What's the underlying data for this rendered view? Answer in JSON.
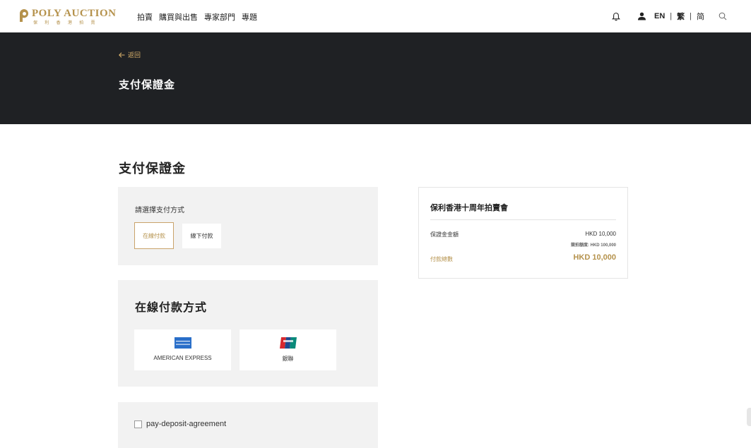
{
  "header": {
    "logo_text": "POLY AUCTION",
    "logo_sub": "保利香港拍賣",
    "nav": [
      "拍賣",
      "購買與出售",
      "專家部門",
      "專題"
    ],
    "icons": [
      "bell-icon",
      "user-icon",
      "search-icon"
    ],
    "lang_en": "EN",
    "lang_sep": "|",
    "lang_tc": "繁",
    "lang_sc": "简"
  },
  "hero": {
    "back_label": "返回",
    "title": "支付保證金"
  },
  "main": {
    "page_title": "支付保證金",
    "payment_select": {
      "label": "請選擇支付方式",
      "options": [
        "在線付款",
        "線下付款"
      ],
      "selected": "在線付款"
    },
    "online_methods": {
      "title": "在線付款方式",
      "cards": [
        {
          "name": "AMERICAN EXPRESS",
          "icon": "amex-icon"
        },
        {
          "name": "銀聯",
          "icon": "unionpay-icon"
        }
      ]
    },
    "agreement": {
      "label": "pay-deposit-agreement",
      "checked": false
    }
  },
  "summary": {
    "title": "保利香港十周年拍賣會",
    "deposit_label": "保證金金額",
    "deposit_value": "HKD 10,000",
    "bid_limit": "競拍額度: HKD 100,000",
    "total_label": "付款總數",
    "total_value": "HKD 10,000"
  },
  "colors": {
    "gold": "#b5924c",
    "hero_bg": "#1f2124",
    "panel_bg": "#f2f2f2"
  }
}
